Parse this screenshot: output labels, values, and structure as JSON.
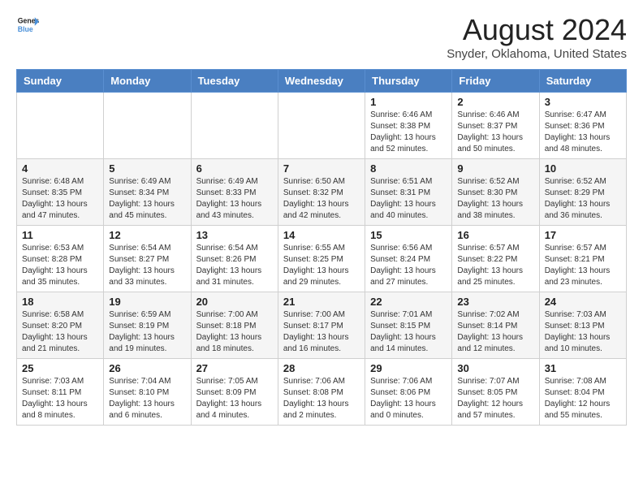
{
  "header": {
    "logo_line1": "General",
    "logo_line2": "Blue",
    "title": "August 2024",
    "subtitle": "Snyder, Oklahoma, United States"
  },
  "weekdays": [
    "Sunday",
    "Monday",
    "Tuesday",
    "Wednesday",
    "Thursday",
    "Friday",
    "Saturday"
  ],
  "weeks": [
    [
      {
        "day": "",
        "info": ""
      },
      {
        "day": "",
        "info": ""
      },
      {
        "day": "",
        "info": ""
      },
      {
        "day": "",
        "info": ""
      },
      {
        "day": "1",
        "info": "Sunrise: 6:46 AM\nSunset: 8:38 PM\nDaylight: 13 hours\nand 52 minutes."
      },
      {
        "day": "2",
        "info": "Sunrise: 6:46 AM\nSunset: 8:37 PM\nDaylight: 13 hours\nand 50 minutes."
      },
      {
        "day": "3",
        "info": "Sunrise: 6:47 AM\nSunset: 8:36 PM\nDaylight: 13 hours\nand 48 minutes."
      }
    ],
    [
      {
        "day": "4",
        "info": "Sunrise: 6:48 AM\nSunset: 8:35 PM\nDaylight: 13 hours\nand 47 minutes."
      },
      {
        "day": "5",
        "info": "Sunrise: 6:49 AM\nSunset: 8:34 PM\nDaylight: 13 hours\nand 45 minutes."
      },
      {
        "day": "6",
        "info": "Sunrise: 6:49 AM\nSunset: 8:33 PM\nDaylight: 13 hours\nand 43 minutes."
      },
      {
        "day": "7",
        "info": "Sunrise: 6:50 AM\nSunset: 8:32 PM\nDaylight: 13 hours\nand 42 minutes."
      },
      {
        "day": "8",
        "info": "Sunrise: 6:51 AM\nSunset: 8:31 PM\nDaylight: 13 hours\nand 40 minutes."
      },
      {
        "day": "9",
        "info": "Sunrise: 6:52 AM\nSunset: 8:30 PM\nDaylight: 13 hours\nand 38 minutes."
      },
      {
        "day": "10",
        "info": "Sunrise: 6:52 AM\nSunset: 8:29 PM\nDaylight: 13 hours\nand 36 minutes."
      }
    ],
    [
      {
        "day": "11",
        "info": "Sunrise: 6:53 AM\nSunset: 8:28 PM\nDaylight: 13 hours\nand 35 minutes."
      },
      {
        "day": "12",
        "info": "Sunrise: 6:54 AM\nSunset: 8:27 PM\nDaylight: 13 hours\nand 33 minutes."
      },
      {
        "day": "13",
        "info": "Sunrise: 6:54 AM\nSunset: 8:26 PM\nDaylight: 13 hours\nand 31 minutes."
      },
      {
        "day": "14",
        "info": "Sunrise: 6:55 AM\nSunset: 8:25 PM\nDaylight: 13 hours\nand 29 minutes."
      },
      {
        "day": "15",
        "info": "Sunrise: 6:56 AM\nSunset: 8:24 PM\nDaylight: 13 hours\nand 27 minutes."
      },
      {
        "day": "16",
        "info": "Sunrise: 6:57 AM\nSunset: 8:22 PM\nDaylight: 13 hours\nand 25 minutes."
      },
      {
        "day": "17",
        "info": "Sunrise: 6:57 AM\nSunset: 8:21 PM\nDaylight: 13 hours\nand 23 minutes."
      }
    ],
    [
      {
        "day": "18",
        "info": "Sunrise: 6:58 AM\nSunset: 8:20 PM\nDaylight: 13 hours\nand 21 minutes."
      },
      {
        "day": "19",
        "info": "Sunrise: 6:59 AM\nSunset: 8:19 PM\nDaylight: 13 hours\nand 19 minutes."
      },
      {
        "day": "20",
        "info": "Sunrise: 7:00 AM\nSunset: 8:18 PM\nDaylight: 13 hours\nand 18 minutes."
      },
      {
        "day": "21",
        "info": "Sunrise: 7:00 AM\nSunset: 8:17 PM\nDaylight: 13 hours\nand 16 minutes."
      },
      {
        "day": "22",
        "info": "Sunrise: 7:01 AM\nSunset: 8:15 PM\nDaylight: 13 hours\nand 14 minutes."
      },
      {
        "day": "23",
        "info": "Sunrise: 7:02 AM\nSunset: 8:14 PM\nDaylight: 13 hours\nand 12 minutes."
      },
      {
        "day": "24",
        "info": "Sunrise: 7:03 AM\nSunset: 8:13 PM\nDaylight: 13 hours\nand 10 minutes."
      }
    ],
    [
      {
        "day": "25",
        "info": "Sunrise: 7:03 AM\nSunset: 8:11 PM\nDaylight: 13 hours\nand 8 minutes."
      },
      {
        "day": "26",
        "info": "Sunrise: 7:04 AM\nSunset: 8:10 PM\nDaylight: 13 hours\nand 6 minutes."
      },
      {
        "day": "27",
        "info": "Sunrise: 7:05 AM\nSunset: 8:09 PM\nDaylight: 13 hours\nand 4 minutes."
      },
      {
        "day": "28",
        "info": "Sunrise: 7:06 AM\nSunset: 8:08 PM\nDaylight: 13 hours\nand 2 minutes."
      },
      {
        "day": "29",
        "info": "Sunrise: 7:06 AM\nSunset: 8:06 PM\nDaylight: 13 hours\nand 0 minutes."
      },
      {
        "day": "30",
        "info": "Sunrise: 7:07 AM\nSunset: 8:05 PM\nDaylight: 12 hours\nand 57 minutes."
      },
      {
        "day": "31",
        "info": "Sunrise: 7:08 AM\nSunset: 8:04 PM\nDaylight: 12 hours\nand 55 minutes."
      }
    ]
  ]
}
